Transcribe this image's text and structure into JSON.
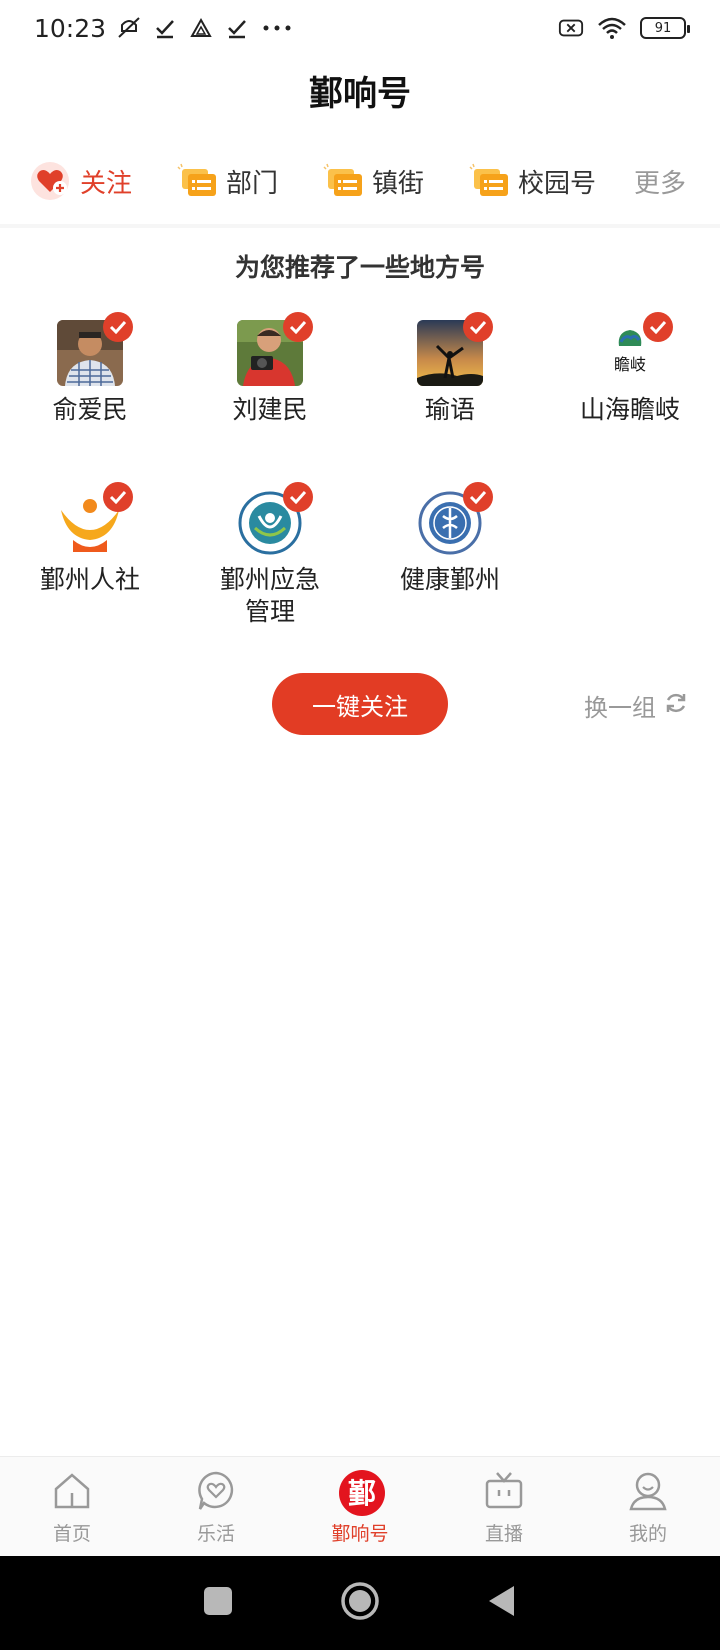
{
  "status_bar": {
    "time": "10:23",
    "battery": "91",
    "icons": [
      "mute-icon",
      "check-icon",
      "drive-icon",
      "check-icon",
      "more-dots-icon",
      "sim-off-icon",
      "wifi-icon",
      "battery-icon"
    ]
  },
  "header": {
    "title": "鄞响号"
  },
  "tabs": [
    {
      "label": "关注",
      "icon": "heart-plus-icon",
      "active": true
    },
    {
      "label": "部门",
      "icon": "message-list-icon"
    },
    {
      "label": "镇街",
      "icon": "message-list-icon"
    },
    {
      "label": "校园号",
      "icon": "message-list-icon"
    },
    {
      "label": "更多",
      "icon": null
    }
  ],
  "recommend": {
    "heading": "为您推荐了一些地方号",
    "accounts": [
      {
        "name": "俞爱民",
        "selected": true
      },
      {
        "name": "刘建民",
        "selected": true
      },
      {
        "name": "瑜语",
        "selected": true
      },
      {
        "name": "山海瞻岐",
        "selected": true,
        "logo_text": "瞻岐"
      },
      {
        "name": "鄞州人社",
        "selected": true
      },
      {
        "name_line1": "鄞州应急",
        "name_line2": "管理",
        "selected": true
      },
      {
        "name": "健康鄞州",
        "selected": true
      }
    ],
    "follow_all_label": "一键关注",
    "refresh_label": "换一组"
  },
  "bottom_nav": [
    {
      "label": "首页",
      "icon": "home-icon"
    },
    {
      "label": "乐活",
      "icon": "heart-chat-icon"
    },
    {
      "label": "鄞响号",
      "icon": "yin-logo-icon",
      "active": true,
      "logo_text": "鄞"
    },
    {
      "label": "直播",
      "icon": "tv-icon"
    },
    {
      "label": "我的",
      "icon": "profile-icon"
    }
  ],
  "colors": {
    "accent": "#e0402a",
    "button": "#e23c24",
    "muted": "#999999"
  }
}
